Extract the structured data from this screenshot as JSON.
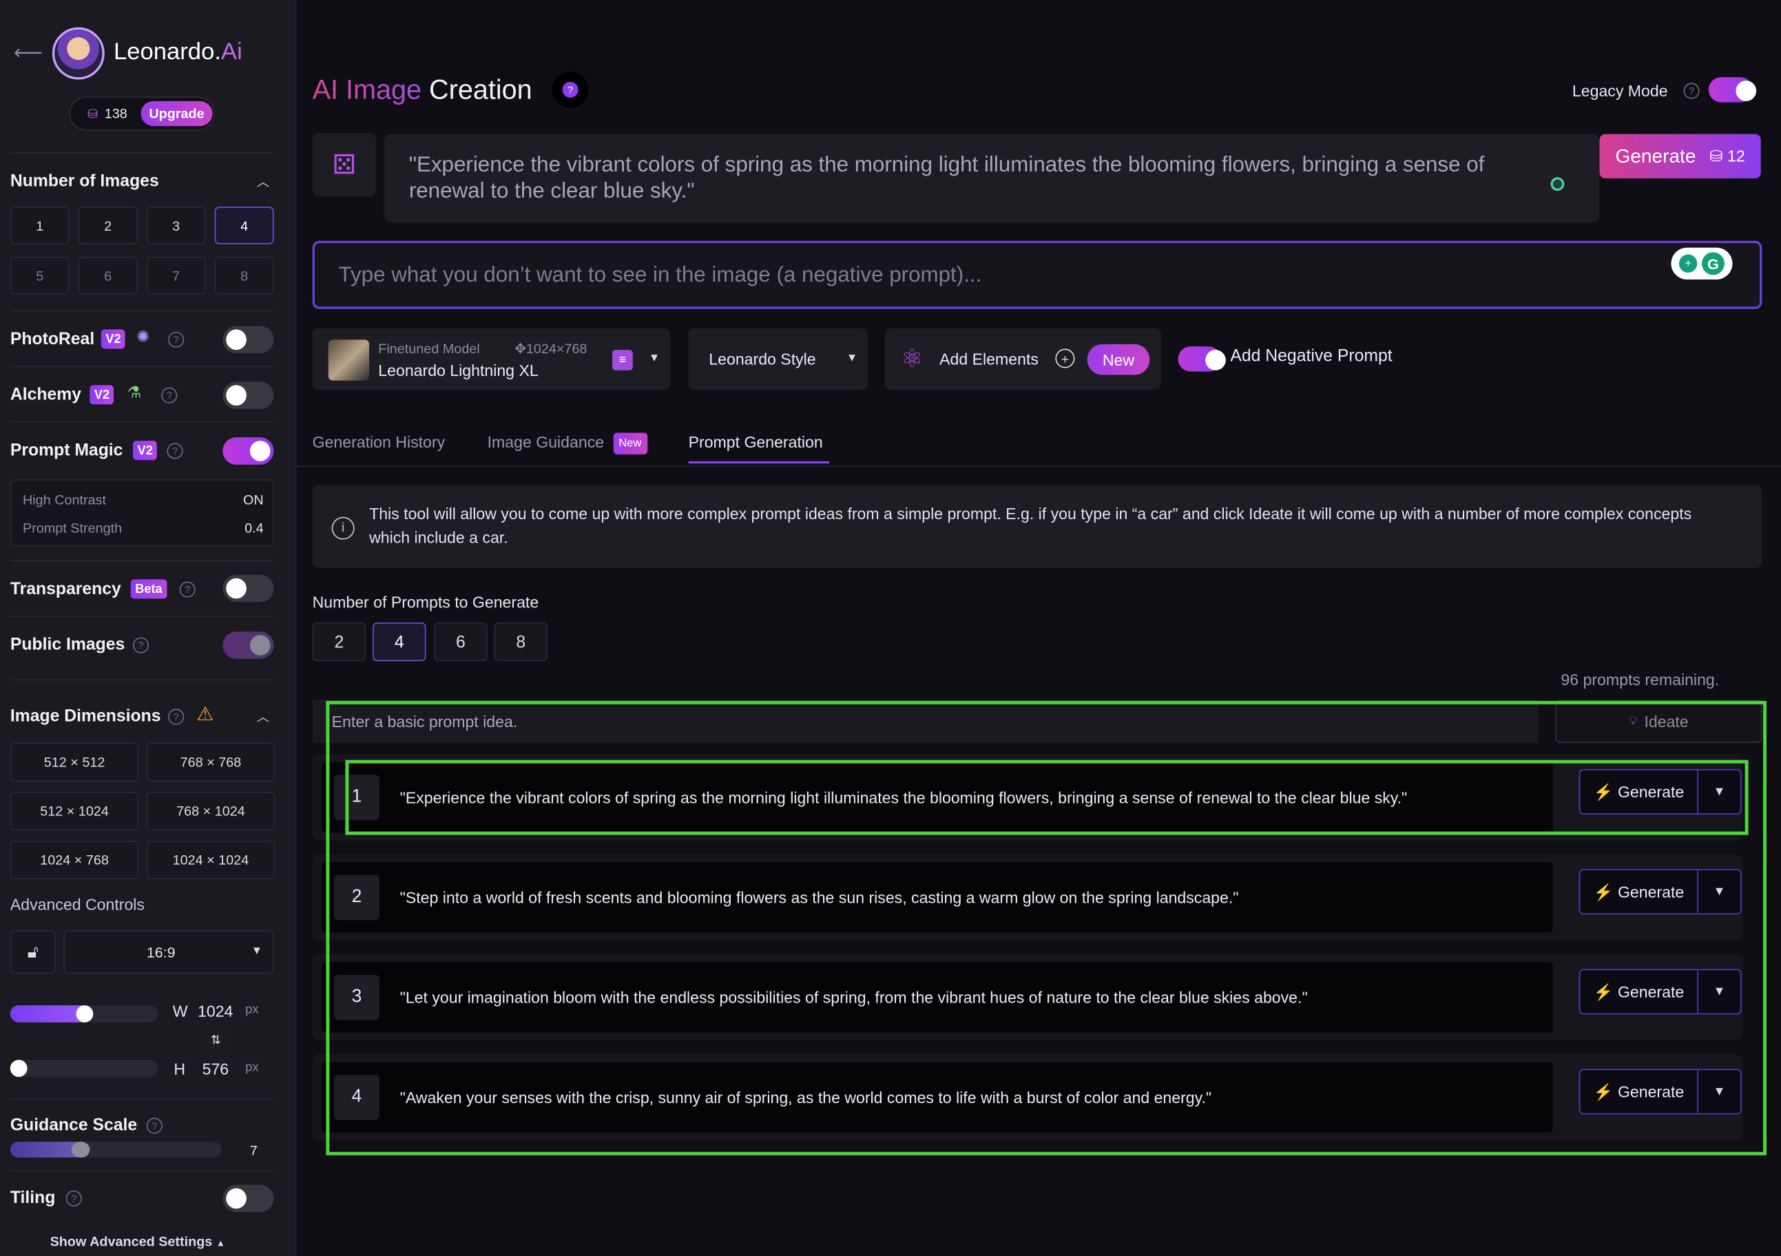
{
  "brand": {
    "name_main": "Leonardo.",
    "name_accent": "Ai"
  },
  "credits": {
    "count": "138",
    "upgrade_label": "Upgrade"
  },
  "sidebar": {
    "num_images": {
      "title": "Number of Images",
      "options": [
        "1",
        "2",
        "3",
        "4",
        "5",
        "6",
        "7",
        "8"
      ],
      "selected": "4"
    },
    "photoreal": {
      "label": "PhotoReal",
      "badge": "V2",
      "enabled": false
    },
    "alchemy": {
      "label": "Alchemy",
      "badge": "V2",
      "enabled": false
    },
    "prompt_magic": {
      "label": "Prompt Magic",
      "badge": "V2",
      "enabled": true,
      "settings": [
        {
          "label": "High Contrast",
          "value": "ON"
        },
        {
          "label": "Prompt Strength",
          "value": "0.4"
        }
      ]
    },
    "transparency": {
      "label": "Transparency",
      "badge": "Beta",
      "enabled": false
    },
    "public_images": {
      "label": "Public Images",
      "enabled": true
    },
    "image_dimensions": {
      "title": "Image Dimensions",
      "options": [
        "512 × 512",
        "768 × 768",
        "512 × 1024",
        "768 × 1024",
        "1024 × 768",
        "1024 × 1024"
      ]
    },
    "advanced_controls": {
      "label": "Advanced Controls",
      "aspect_ratio": "16:9"
    },
    "width": {
      "label": "W",
      "value": "1024",
      "unit": "px",
      "slider_fraction": 0.5
    },
    "height": {
      "label": "H",
      "value": "576",
      "unit": "px",
      "slider_fraction": 0.0
    },
    "guidance_scale": {
      "label": "Guidance Scale",
      "value": "7",
      "slider_fraction": 0.32
    },
    "tiling": {
      "label": "Tiling",
      "enabled": false
    },
    "show_advanced": "Show Advanced Settings"
  },
  "header": {
    "title_accent": "AI Image",
    "title_rest": "Creation",
    "legacy_mode": "Legacy Mode",
    "legacy_enabled": true
  },
  "prompt": {
    "text": "\"Experience the vibrant colors of spring as the morning light illuminates the blooming flowers, bringing a sense of renewal to the clear blue sky.\""
  },
  "generate": {
    "label": "Generate",
    "cost": "12"
  },
  "negative_prompt": {
    "placeholder": "Type what you don’t want to see in the image (a negative prompt)..."
  },
  "model": {
    "caption": "Finetuned Model",
    "dims": "1024×768",
    "name": "Leonardo Lightning XL"
  },
  "style": {
    "label": "Leonardo Style"
  },
  "elements": {
    "label": "Add Elements",
    "badge": "New"
  },
  "neg_toggle": {
    "label": "Add Negative Prompt",
    "enabled": true
  },
  "tabs": [
    {
      "label": "Generation History"
    },
    {
      "label": "Image Guidance",
      "badge": "New"
    },
    {
      "label": "Prompt Generation",
      "active": true
    }
  ],
  "info": {
    "text": "This tool will allow you to come up with more complex prompt ideas from a simple prompt. E.g. if you type in “a car” and click Ideate it will come up with a number of more complex concepts which include a car."
  },
  "prompt_count": {
    "label": "Number of Prompts to Generate",
    "options": [
      "2",
      "4",
      "6",
      "8"
    ],
    "selected": "4"
  },
  "remaining": "96 prompts remaining.",
  "idea_input": {
    "placeholder": "Enter a basic prompt idea."
  },
  "ideate": {
    "label": "Ideate"
  },
  "generated_prompts": [
    {
      "num": "1",
      "text": "\"Experience the vibrant colors of spring as the morning light illuminates the blooming flowers, bringing a sense of renewal to the clear blue sky.\"",
      "button": "Generate"
    },
    {
      "num": "2",
      "text": "\"Step into a world of fresh scents and blooming flowers as the sun rises, casting a warm glow on the spring landscape.\"",
      "button": "Generate"
    },
    {
      "num": "3",
      "text": "\"Let your imagination bloom with the endless possibilities of spring, from the vibrant hues of nature to the clear blue skies above.\"",
      "button": "Generate"
    },
    {
      "num": "4",
      "text": "\"Awaken your senses with the crisp, sunny air of spring, as the world comes to life with a burst of color and energy.\"",
      "button": "Generate"
    }
  ],
  "colors": {
    "accent_purple": "#8b3cf0",
    "accent_pink": "#d63d8e",
    "highlight_green": "#4cd63a",
    "bg": "#0f0e14"
  }
}
